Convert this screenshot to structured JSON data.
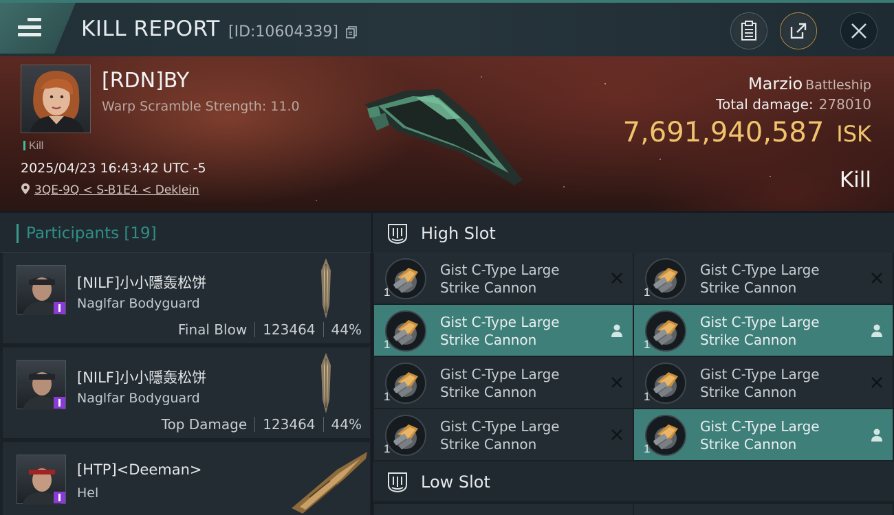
{
  "header": {
    "title": "KILL REPORT",
    "id_label": "[ID:10604339]"
  },
  "victim": {
    "name": "[RDN]BY",
    "warp_scramble": "Warp Scramble Strength: 11.0",
    "status_tag": "Kill",
    "timestamp": "2025/04/23 16:43:42 UTC -5",
    "location": "3QE-9Q < S-B1E4 < Deklein",
    "ship_name": "Marzio",
    "ship_class": "Battleship",
    "total_damage_label": "Total damage:",
    "total_damage_value": "278010",
    "isk_value": "7,691,940,587",
    "isk_unit": "ISK",
    "result": "Kill"
  },
  "participants": {
    "label": "Participants",
    "count": "[19]",
    "items": [
      {
        "name": "[NILF]小小隱轰松饼",
        "ship": "Naglfar Bodyguard",
        "role": "Final Blow",
        "damage": "123464",
        "percent": "44%"
      },
      {
        "name": "[NILF]小小隱轰松饼",
        "ship": "Naglfar Bodyguard",
        "role": "Top Damage",
        "damage": "123464",
        "percent": "44%"
      },
      {
        "name": "[HTP]<Deeman>",
        "ship": "Hel",
        "role": "",
        "damage": "",
        "percent": ""
      }
    ]
  },
  "slots": {
    "high_slot_label": "High Slot",
    "low_slot_label": "Low Slot",
    "modules": [
      {
        "line1": "Gist C-Type Large",
        "line2": "Strike Cannon",
        "qty": "1",
        "state": "destroyed"
      },
      {
        "line1": "Gist C-Type Large",
        "line2": "Strike Cannon",
        "qty": "1",
        "state": "destroyed"
      },
      {
        "line1": "Gist C-Type Large",
        "line2": "Strike Cannon",
        "qty": "1",
        "state": "dropped"
      },
      {
        "line1": "Gist C-Type Large",
        "line2": "Strike Cannon",
        "qty": "1",
        "state": "dropped"
      },
      {
        "line1": "Gist C-Type Large",
        "line2": "Strike Cannon",
        "qty": "1",
        "state": "destroyed"
      },
      {
        "line1": "Gist C-Type Large",
        "line2": "Strike Cannon",
        "qty": "1",
        "state": "destroyed"
      },
      {
        "line1": "Gist C-Type Large",
        "line2": "Strike Cannon",
        "qty": "1",
        "state": "destroyed"
      },
      {
        "line1": "Gist C-Type Large",
        "line2": "Strike Cannon",
        "qty": "1",
        "state": "dropped"
      }
    ]
  },
  "colors": {
    "accent_teal": "#3f7f79",
    "isk_gold": "#f0c46c",
    "badge_purple": "#8a3bd6"
  },
  "icons": {
    "menu": "hamburger-icon",
    "copy": "copy-icon",
    "clipboard": "clipboard-icon",
    "share": "share-icon",
    "close": "close-icon",
    "location": "location-pin-icon",
    "slot": "slot-icon",
    "destroyed": "x-icon",
    "dropped": "person-icon"
  }
}
